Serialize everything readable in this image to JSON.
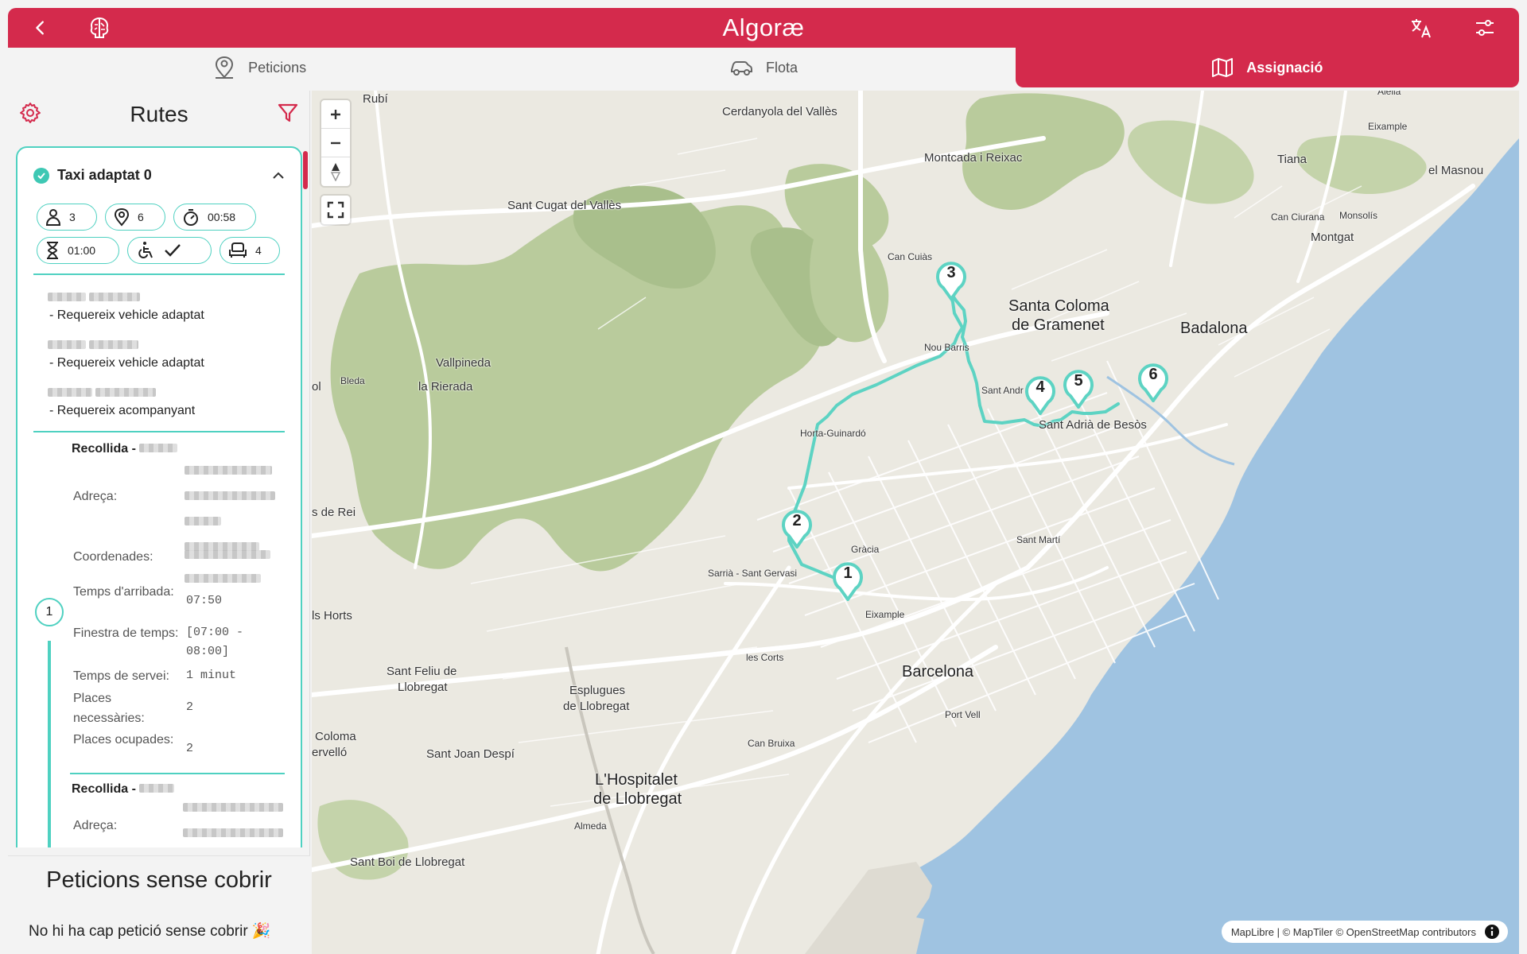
{
  "header": {
    "title": "Algoræ",
    "back_icon": "chevron-left-icon",
    "logo_icon": "brain-logo-icon",
    "translate_icon": "translate-icon",
    "settings_icon": "sliders-icon"
  },
  "tabs": [
    {
      "label": "Peticions",
      "icon": "person-pin-icon",
      "active": false
    },
    {
      "label": "Flota",
      "icon": "car-icon",
      "active": false
    },
    {
      "label": "Assignació",
      "icon": "map-icon",
      "active": true
    }
  ],
  "sidebar": {
    "title": "Rutes",
    "route": {
      "name": "Taxi adaptat 0",
      "chips": {
        "passengers": "3",
        "stops": "6",
        "duration": "00:58",
        "wait": "01:00",
        "seats": "4"
      },
      "requirements": [
        "- Requereix vehicle adaptat",
        "- Requereix vehicle adaptat",
        "- Requereix acompanyant"
      ],
      "stop1": {
        "number": "1",
        "title": "Recollida -",
        "address_label": "Adreça:",
        "coords_label": "Coordenades:",
        "arrival_label": "Temps d'arribada:",
        "arrival_value": "07:50",
        "window_label": "Finestra de temps:",
        "window_value": "[07:00 - 08:00]",
        "service_label": "Temps de servei:",
        "service_value": "1 minut",
        "needed_label": "Places necessàries:",
        "needed_value": "2",
        "occupied_label": "Places ocupades:",
        "occupied_value": "2"
      },
      "stop2": {
        "title": "Recollida -",
        "address_label": "Adreça:"
      }
    }
  },
  "uncovered": {
    "title": "Peticions sense cobrir",
    "message": "No hi ha cap petició sense cobrir 🎉"
  },
  "map": {
    "places": [
      {
        "id": "rubi",
        "name": "Rubí"
      },
      {
        "id": "cerdanyola",
        "name": "Cerdanyola del Vallès"
      },
      {
        "id": "montcada",
        "name": "Montcada i Reixac"
      },
      {
        "id": "tiana",
        "name": "Tiana"
      },
      {
        "id": "masnou",
        "name": "el Masnou"
      },
      {
        "id": "alella",
        "name": "Alella"
      },
      {
        "id": "eixample_ne",
        "name": "Eixample"
      },
      {
        "id": "santcugat",
        "name": "Sant Cugat del Vallès"
      },
      {
        "id": "cancuias",
        "name": "Can Cuiàs"
      },
      {
        "id": "santacoloma1",
        "name": "Santa Coloma"
      },
      {
        "id": "santacoloma2",
        "name": "de Gramenet"
      },
      {
        "id": "badalona",
        "name": "Badalona"
      },
      {
        "id": "canciurana",
        "name": "Can Ciurana"
      },
      {
        "id": "monsolis",
        "name": "Monsolís"
      },
      {
        "id": "montgat",
        "name": "Montgat"
      },
      {
        "id": "noubarris",
        "name": "Nou Barris"
      },
      {
        "id": "vallpineda",
        "name": "Vallpineda"
      },
      {
        "id": "lariera",
        "name": "la Rierada"
      },
      {
        "id": "bleda",
        "name": "Bleda"
      },
      {
        "id": "ol",
        "name": "ol"
      },
      {
        "id": "santandreu",
        "name": "Sant Andr"
      },
      {
        "id": "santadria",
        "name": "Sant Adrià de Besòs"
      },
      {
        "id": "hortaguinardo",
        "name": "Horta-Guinardó"
      },
      {
        "id": "derei",
        "name": "s de Rei"
      },
      {
        "id": "gracia",
        "name": "Gràcia"
      },
      {
        "id": "santmarti",
        "name": "Sant Martí"
      },
      {
        "id": "sarria",
        "name": "Sarrià - Sant Gervasi"
      },
      {
        "id": "horts",
        "name": "ls Horts"
      },
      {
        "id": "eixample",
        "name": "Eixample"
      },
      {
        "id": "lescorts",
        "name": "les Corts"
      },
      {
        "id": "santfeliu1",
        "name": "Sant Feliu de"
      },
      {
        "id": "santfeliu2",
        "name": "Llobregat"
      },
      {
        "id": "esplugues1",
        "name": "Esplugues"
      },
      {
        "id": "esplugues2",
        "name": "de Llobregat"
      },
      {
        "id": "barcelona",
        "name": "Barcelona"
      },
      {
        "id": "portvell",
        "name": "Port Vell"
      },
      {
        "id": "coloma1",
        "name": "Coloma"
      },
      {
        "id": "coloma2",
        "name": "ervelló"
      },
      {
        "id": "santjoan",
        "name": "Sant Joan Despí"
      },
      {
        "id": "canbruixa",
        "name": "Can Bruixa"
      },
      {
        "id": "hospitalet1",
        "name": "L'Hospitalet"
      },
      {
        "id": "hospitalet2",
        "name": "de Llobregat"
      },
      {
        "id": "almeda",
        "name": "Almeda"
      },
      {
        "id": "santboi",
        "name": "Sant Boi de Llobregat"
      }
    ],
    "markers": [
      "1",
      "2",
      "3",
      "4",
      "5",
      "6"
    ],
    "route_color": "#5dd3c3",
    "attribution": "MapLibre | © MapTiler © OpenStreetMap contributors"
  },
  "colors": {
    "accent": "#d42a4c",
    "teal": "#4fd1c1",
    "sea": "#9ec3e0",
    "park": "#b6c89a"
  }
}
